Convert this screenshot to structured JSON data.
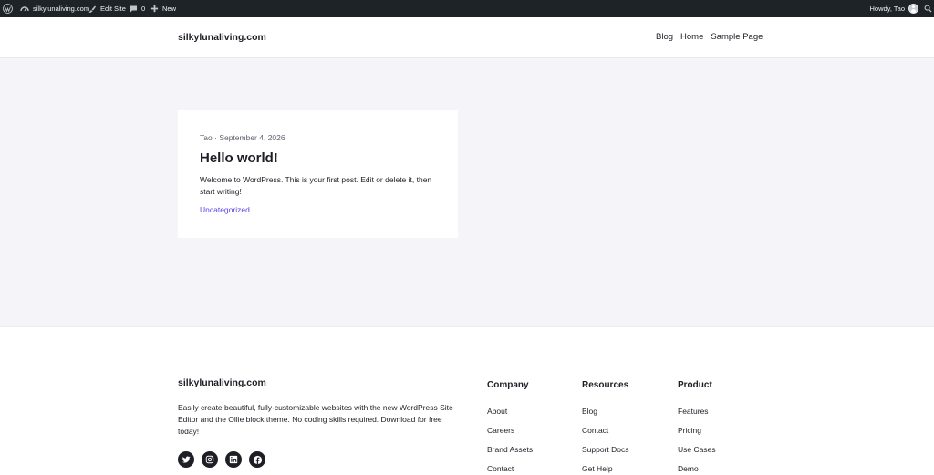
{
  "adminbar": {
    "site_name": "silkylunaliving.com",
    "edit_site": "Edit Site",
    "comments_count": "0",
    "new_label": "New",
    "howdy": "Howdy, Tao"
  },
  "header": {
    "site_title": "silkylunaliving.com",
    "nav": [
      "Blog",
      "Home",
      "Sample Page"
    ]
  },
  "post": {
    "author": "Tao",
    "separator": "·",
    "date": "September 4, 2026",
    "title": "Hello world!",
    "excerpt": "Welcome to WordPress. This is your first post. Edit or delete it, then start writing!",
    "category": "Uncategorized"
  },
  "footer": {
    "site_title": "silkylunaliving.com",
    "description": "Easily create beautiful, fully-customizable websites with the new WordPress Site Editor and the Ollie block theme. No coding skills required. Download for free today!",
    "socials": [
      "twitter-icon",
      "instagram-icon",
      "linkedin-icon",
      "facebook-icon"
    ],
    "columns": [
      {
        "heading": "Company",
        "links": [
          "About",
          "Careers",
          "Brand Assets",
          "Contact"
        ]
      },
      {
        "heading": "Resources",
        "links": [
          "Blog",
          "Contact",
          "Support Docs",
          "Get Help"
        ]
      },
      {
        "heading": "Product",
        "links": [
          "Features",
          "Pricing",
          "Use Cases",
          "Demo"
        ]
      }
    ]
  },
  "colors": {
    "adminbar_bg": "#1d2327",
    "accent": "#5844e8",
    "main_bg": "#f5f5f9"
  }
}
